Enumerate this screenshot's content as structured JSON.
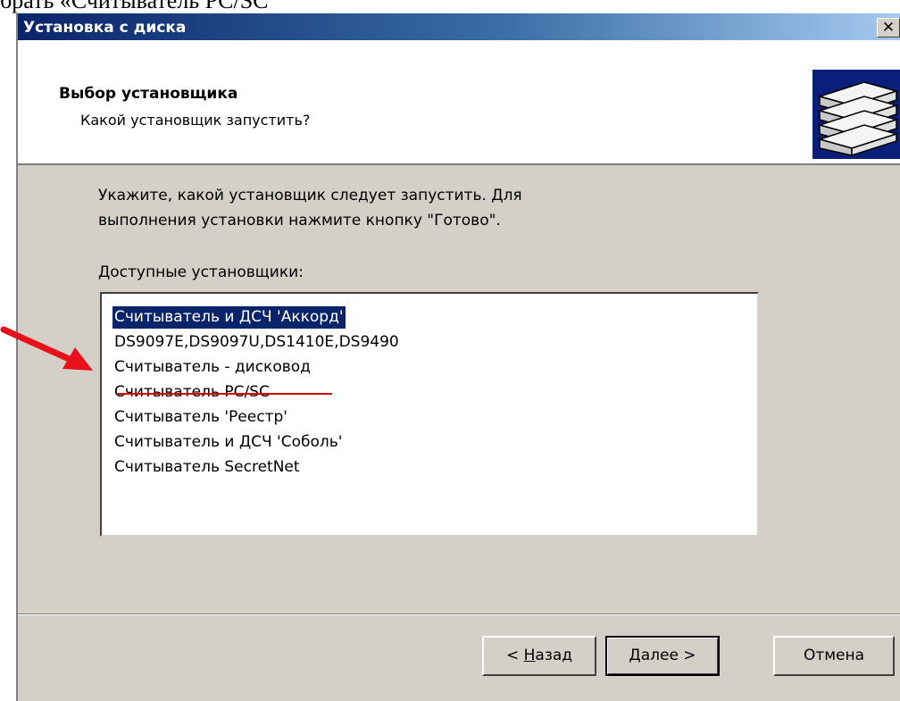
{
  "document": {
    "caption": "брать «Считыватель PC/SC»."
  },
  "dialog": {
    "title": "Установка с диска",
    "close_label": "✕",
    "header": {
      "title": "Выбор установщика",
      "subtitle": "Какой установщик запустить?",
      "icon": "install-disk-icon"
    },
    "instruction": {
      "line1": "Укажите, какой установщик следует запустить. Для",
      "line2": "выполнения установки нажмите кнопку \"Готово\"."
    },
    "list_label": {
      "underlined": "Д",
      "rest": "оступные установщики:"
    },
    "installers": [
      {
        "label": "Считыватель и ДСЧ 'Аккорд'",
        "selected": true
      },
      {
        "label": "DS9097E,DS9097U,DS1410E,DS9490",
        "selected": false
      },
      {
        "label": "Считыватель - дисковод",
        "selected": false
      },
      {
        "label": "Считыватель PC/SC",
        "selected": false
      },
      {
        "label": "Считыватель 'Реестр'",
        "selected": false
      },
      {
        "label": "Считыватель и ДСЧ 'Соболь'",
        "selected": false
      },
      {
        "label": "Считыватель SecretNet",
        "selected": false
      }
    ],
    "buttons": {
      "back": {
        "prefix": "< ",
        "underlined": "Н",
        "rest": "азад"
      },
      "next": {
        "underlined": "Д",
        "rest": "алее >"
      },
      "cancel": "Отмена"
    }
  },
  "annotation": {
    "color": "#e8101a",
    "highlighted_item": "Считыватель PC/SC"
  },
  "colors": {
    "title_bar": "#0a246a",
    "dialog_bg": "#d4d0c8",
    "selection": "#0a246a"
  }
}
